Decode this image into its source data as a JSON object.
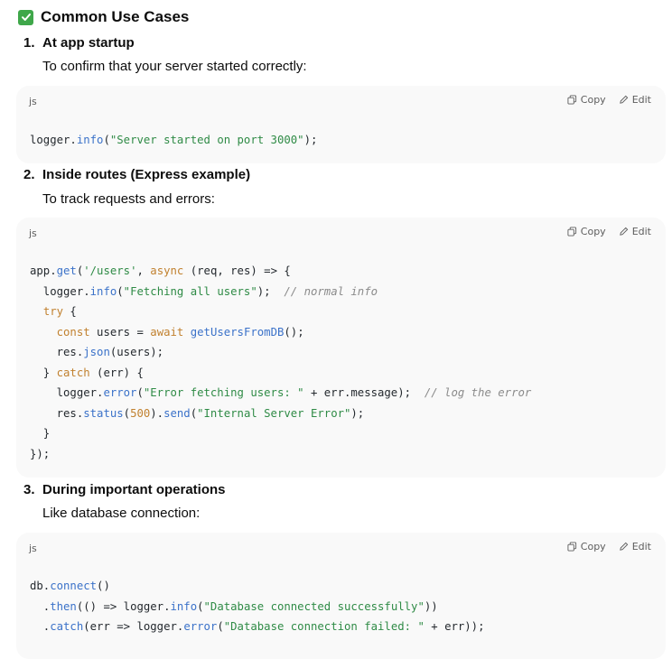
{
  "heading": {
    "icon": "check-box-icon",
    "title": "Common Use Cases"
  },
  "actions": {
    "copy": "Copy",
    "edit": "Edit"
  },
  "items": [
    {
      "number": "1.",
      "title": "At app startup",
      "description": "To confirm that your server started correctly:",
      "lang": "js"
    },
    {
      "number": "2.",
      "title": "Inside routes (Express example)",
      "description": "To track requests and errors:",
      "lang": "js"
    },
    {
      "number": "3.",
      "title": "During important operations",
      "description": "Like database connection:",
      "lang": "js"
    }
  ],
  "code": {
    "block1": {
      "l1": {
        "a": "logger.",
        "b": "info",
        "c": "(",
        "d": "\"Server started on port 3000\"",
        "e": ");"
      }
    },
    "block2": {
      "l1": {
        "a": "app.",
        "b": "get",
        "c": "(",
        "d": "'/users'",
        "e": ", ",
        "f": "async",
        "g": " (req, res) => {"
      },
      "l2": {
        "a": "  logger.",
        "b": "info",
        "c": "(",
        "d": "\"Fetching all users\"",
        "e": ");  ",
        "f": "// normal info"
      },
      "l3": {
        "a": "  ",
        "b": "try",
        "c": " {"
      },
      "l4": {
        "a": "    ",
        "b": "const",
        "c": " users = ",
        "d": "await",
        "e": " ",
        "f": "getUsersFromDB",
        "g": "();"
      },
      "l5": {
        "a": "    res.",
        "b": "json",
        "c": "(users);"
      },
      "l6": {
        "a": "  } ",
        "b": "catch",
        "c": " (err) {"
      },
      "l7": {
        "a": "    logger.",
        "b": "error",
        "c": "(",
        "d": "\"Error fetching users: \"",
        "e": " + err.message);  ",
        "f": "// log the error"
      },
      "l8": {
        "a": "    res.",
        "b": "status",
        "c": "(",
        "d": "500",
        "e": ").",
        "f": "send",
        "g": "(",
        "h": "\"Internal Server Error\"",
        "i": ");"
      },
      "l9": {
        "a": "  }"
      },
      "l10": {
        "a": "});"
      }
    },
    "block3": {
      "l1": {
        "a": "db.",
        "b": "connect",
        "c": "()"
      },
      "l2": {
        "a": "  .",
        "b": "then",
        "c": "(() => logger.",
        "d": "info",
        "e": "(",
        "f": "\"Database connected successfully\"",
        "g": "))"
      },
      "l3": {
        "a": "  .",
        "b": "catch",
        "c": "(err => logger.",
        "d": "error",
        "e": "(",
        "f": "\"Database connection failed: \"",
        "g": " + err));"
      }
    }
  }
}
